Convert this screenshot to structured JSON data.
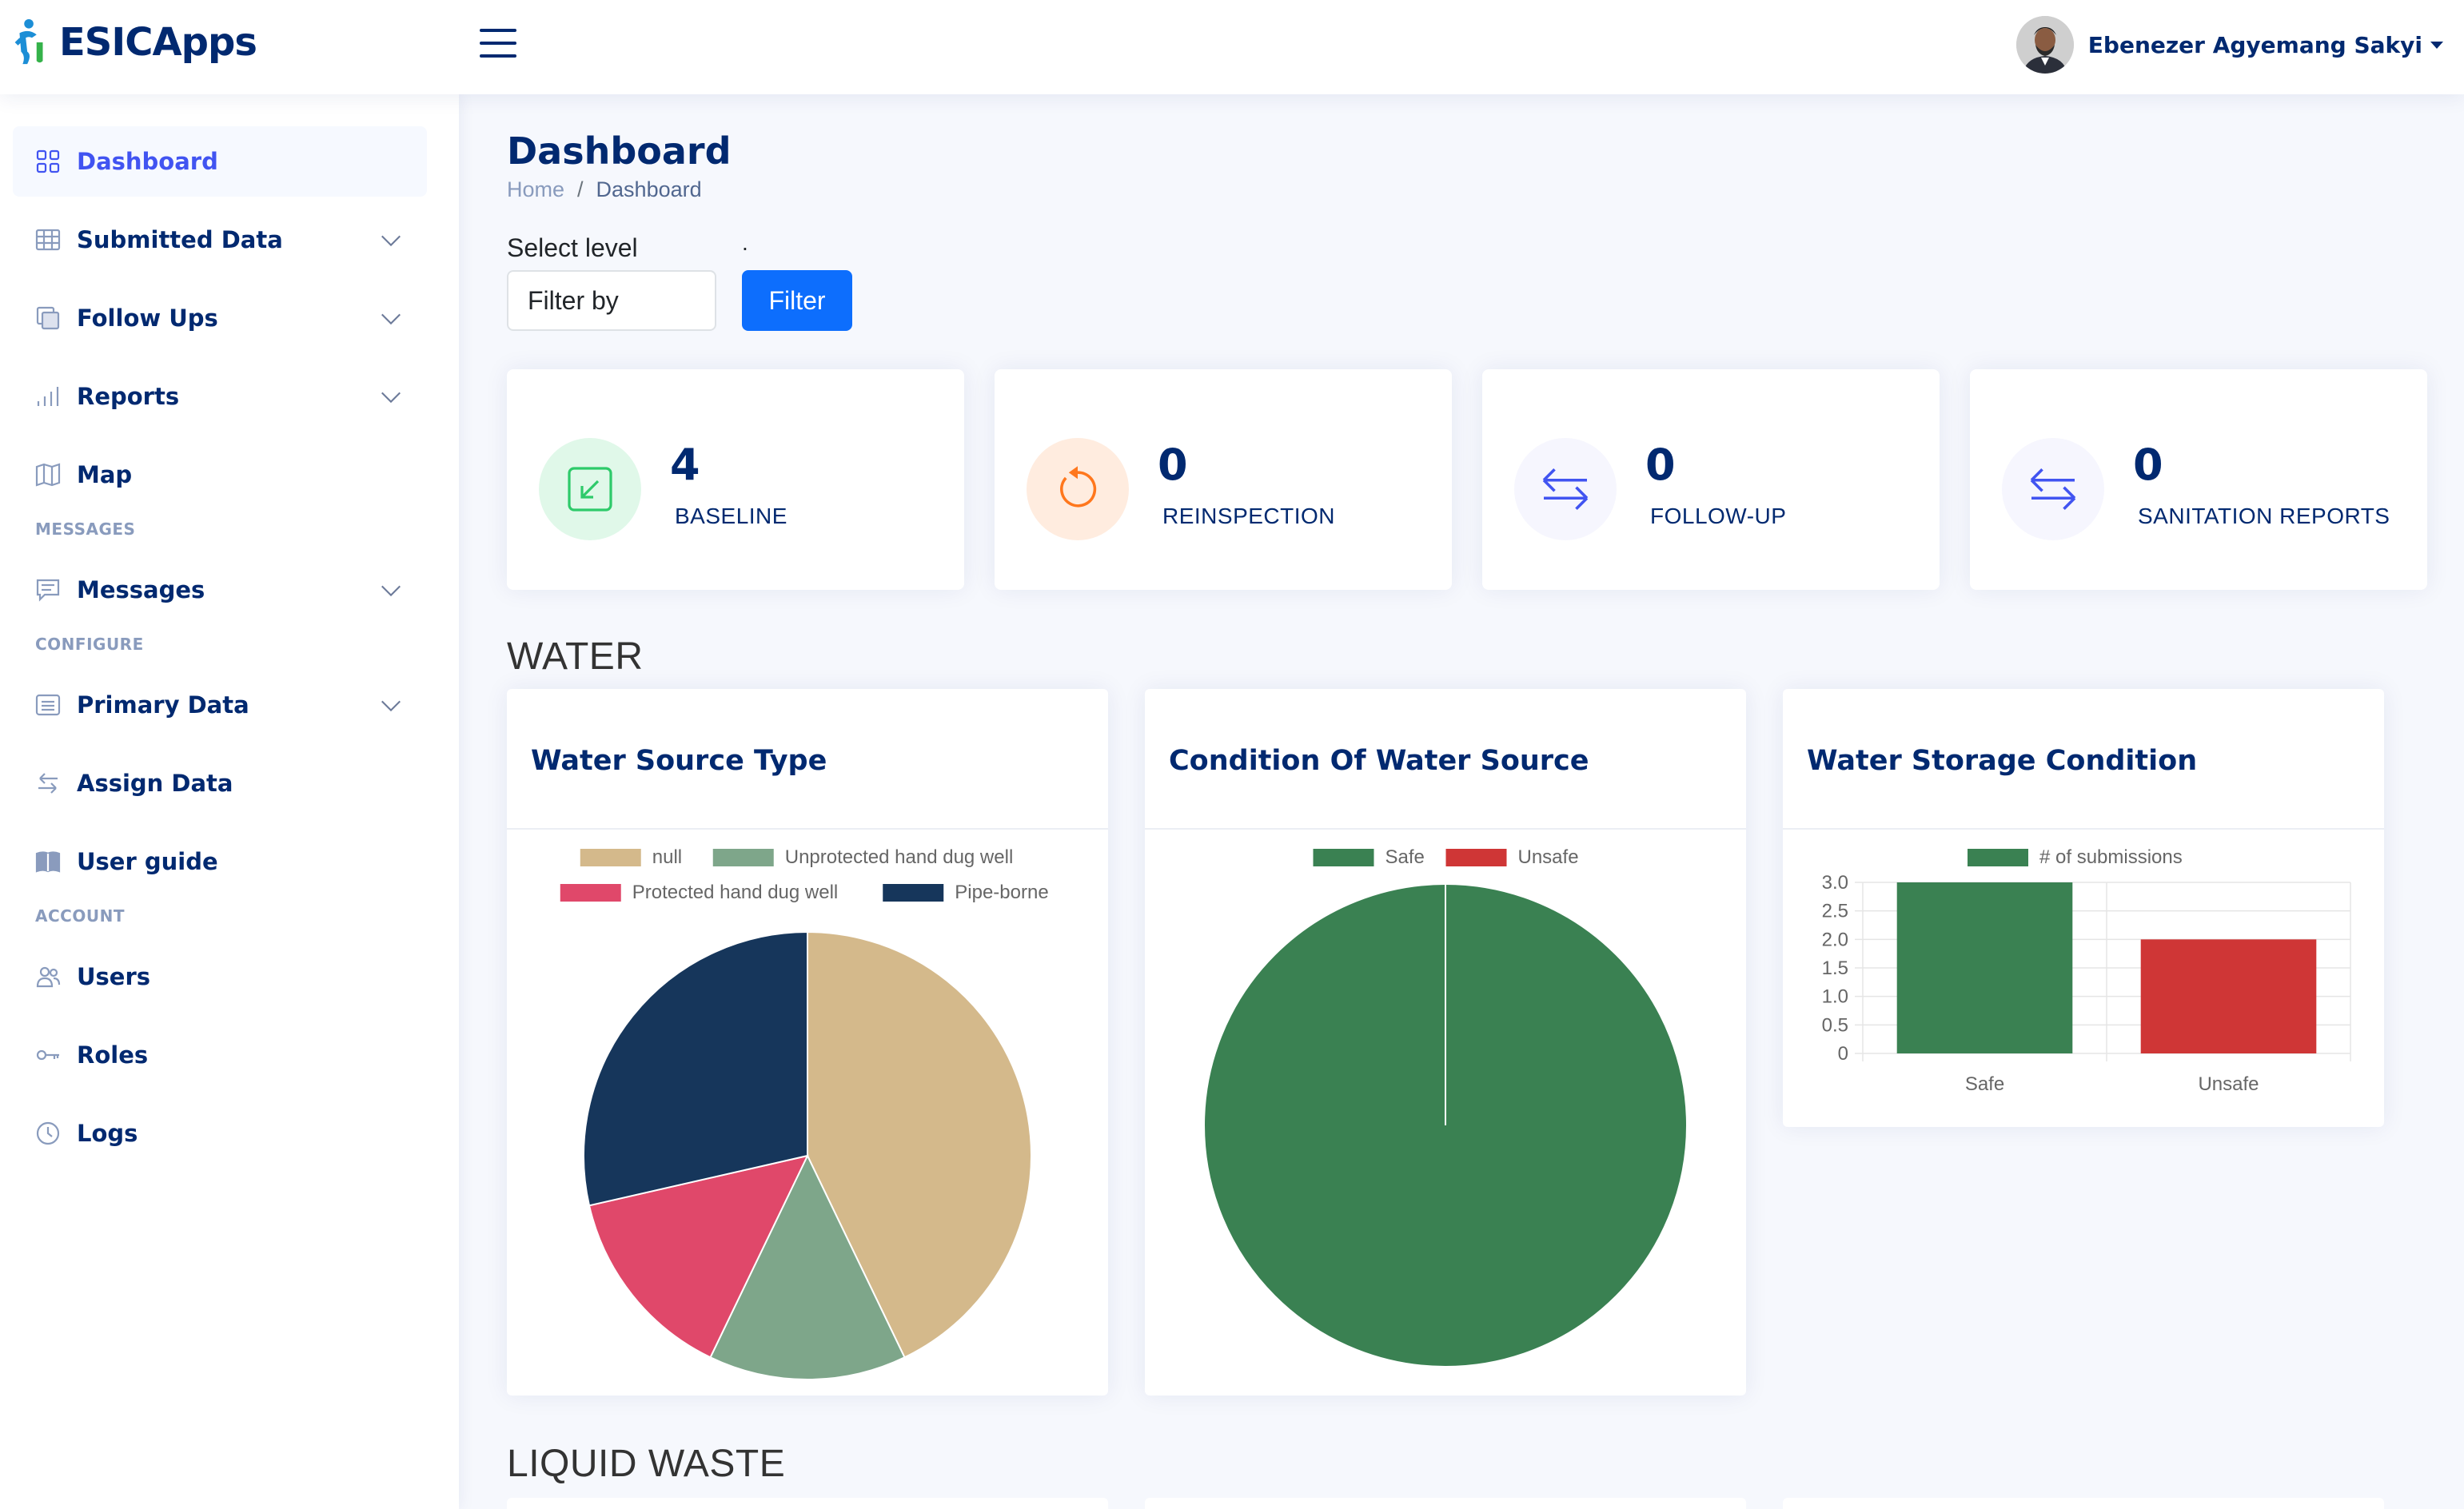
{
  "app": {
    "name": "ESICApps"
  },
  "header": {
    "user_name": "Ebenezer Agyemang Sakyi"
  },
  "sidebar": {
    "items": [
      {
        "label": "Dashboard",
        "icon": "grid-icon",
        "active": true,
        "dropdown": false
      },
      {
        "label": "Submitted Data",
        "icon": "table-icon",
        "active": false,
        "dropdown": true
      },
      {
        "label": "Follow Ups",
        "icon": "layers-icon",
        "active": false,
        "dropdown": true
      },
      {
        "label": "Reports",
        "icon": "bar-chart-icon",
        "active": false,
        "dropdown": true
      },
      {
        "label": "Map",
        "icon": "map-icon",
        "active": false,
        "dropdown": false
      }
    ],
    "messages_heading": "MESSAGES",
    "messages_items": [
      {
        "label": "Messages",
        "icon": "chat-icon",
        "dropdown": true
      }
    ],
    "configure_heading": "CONFIGURE",
    "configure_items": [
      {
        "label": "Primary Data",
        "icon": "list-icon",
        "dropdown": true
      },
      {
        "label": "Assign Data",
        "icon": "arrows-icon",
        "dropdown": false
      },
      {
        "label": "User guide",
        "icon": "book-icon",
        "dropdown": false
      }
    ],
    "account_heading": "ACCOUNT",
    "account_items": [
      {
        "label": "Users",
        "icon": "users-icon",
        "dropdown": false
      },
      {
        "label": "Roles",
        "icon": "key-icon",
        "dropdown": false
      },
      {
        "label": "Logs",
        "icon": "clock-icon",
        "dropdown": false
      }
    ]
  },
  "main": {
    "title": "Dashboard",
    "breadcrumb": {
      "home": "Home",
      "separator": "/",
      "current": "Dashboard"
    },
    "filter": {
      "label": "Select level",
      "dot": ".",
      "select_value": "Filter by",
      "button": "Filter"
    },
    "stats": [
      {
        "value": "4",
        "label": "BASELINE",
        "icon": "arrow-down-left-icon",
        "bg": "#e0f8e9",
        "color": "#2eca6a"
      },
      {
        "value": "0",
        "label": "REINSPECTION",
        "icon": "rotate-icon",
        "bg": "#ffecdf",
        "color": "#ff771d"
      },
      {
        "value": "0",
        "label": "FOLLOW-UP",
        "icon": "swap-arrows-icon",
        "bg": "#f6f6fe",
        "color": "#4154f1"
      },
      {
        "value": "0",
        "label": "SANITATION REPORTS",
        "icon": "swap-arrows-icon",
        "bg": "#f6f6fe",
        "color": "#4154f1"
      }
    ],
    "section_water": "WATER",
    "section_liquid": "LIQUID WASTE"
  },
  "chart_data": [
    {
      "type": "pie",
      "title": "Water Source Type",
      "labels": [
        "null",
        "Unprotected hand dug well",
        "Protected hand dug well",
        "Pipe-borne"
      ],
      "values": [
        3,
        1,
        1,
        2
      ],
      "colors": [
        "#d4b98b",
        "#7ea68a",
        "#e0486a",
        "#16365b"
      ]
    },
    {
      "type": "pie",
      "title": "Condition Of Water Source",
      "labels": [
        "Safe",
        "Unsafe"
      ],
      "values": [
        1,
        0
      ],
      "colors": [
        "#3a8152",
        "#cf3636"
      ]
    },
    {
      "type": "bar",
      "title": "Water Storage Condition",
      "categories": [
        "Safe",
        "Unsafe"
      ],
      "series": [
        {
          "name": "# of submissions",
          "values": [
            3,
            2
          ]
        }
      ],
      "colors": [
        "#3a8152",
        "#cf3636"
      ],
      "ylim": [
        0,
        3
      ],
      "yticks": [
        "3.0",
        "2.5",
        "2.0",
        "1.5",
        "1.0",
        "0.5",
        "0"
      ]
    }
  ]
}
